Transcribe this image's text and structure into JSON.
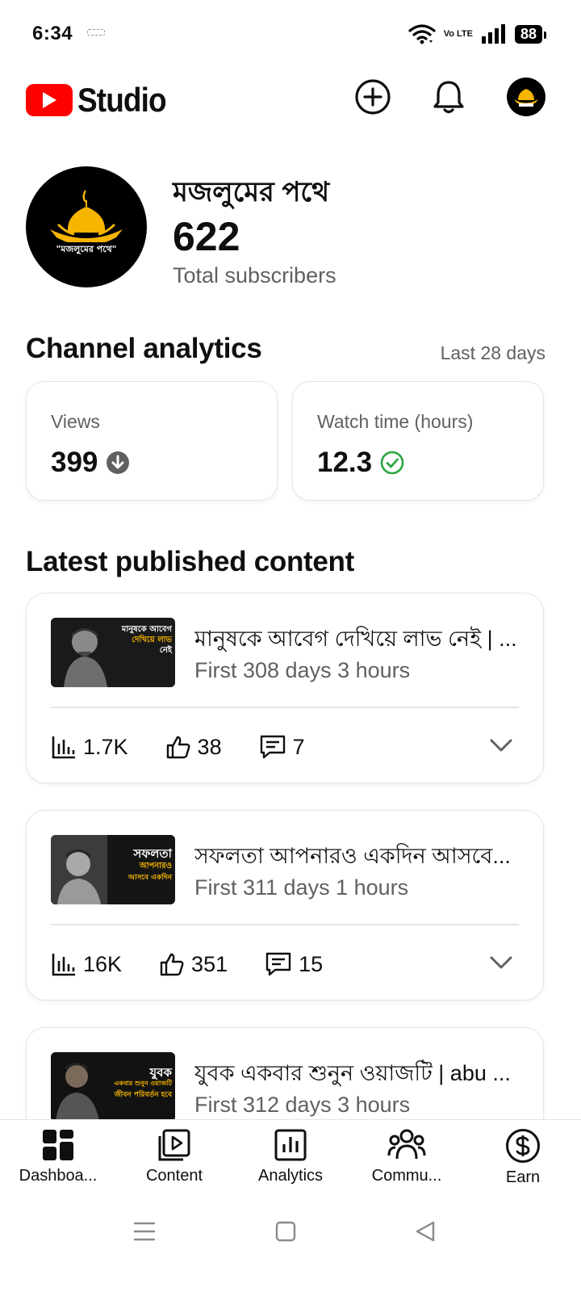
{
  "status_bar": {
    "time": "6:34",
    "network": "Vo LTE",
    "battery": "88"
  },
  "header": {
    "app_name": "Studio",
    "create_icon": "plus-circle-icon",
    "notifications_icon": "bell-icon"
  },
  "channel": {
    "name": "মজলুমের পথে",
    "subscriber_count": "622",
    "subscriber_label": "Total subscribers",
    "avatar_text": "\"মজলুমের পথে\""
  },
  "analytics": {
    "title": "Channel analytics",
    "period": "Last 28 days",
    "metrics": [
      {
        "label": "Views",
        "value": "399",
        "indicator": "down-arrow-icon"
      },
      {
        "label": "Watch time (hours)",
        "value": "12.3",
        "indicator": "check-circle-icon"
      }
    ]
  },
  "latest": {
    "title": "Latest published content",
    "videos": [
      {
        "title": "মানুষকে আবেগ দেখিয়ে লাভ নেই | ...",
        "subtitle": "First 308 days 3 hours",
        "views": "1.7K",
        "likes": "38",
        "comments": "7",
        "thumb_line1": "মানুষকে আবেগ",
        "thumb_line2": "দেখিয়ে লাভ",
        "thumb_line3": "নেই"
      },
      {
        "title": "সফলতা আপনারও একদিন আসবে...",
        "subtitle": "First 311 days 1 hours",
        "views": "16K",
        "likes": "351",
        "comments": "15",
        "thumb_line1": "সফলতা",
        "thumb_line2": "আপনারও",
        "thumb_line3": "আসবে একদিন"
      },
      {
        "title": "যুবক একবার শুনুন ওয়াজটি | abu ...",
        "subtitle": "First 312 days 3 hours",
        "views": "",
        "likes": "",
        "comments": "",
        "thumb_line1": "যুবক",
        "thumb_line2": "একবার শুনুন ওয়াজটি",
        "thumb_line3": "জীবন পরিবর্তন হবে"
      }
    ]
  },
  "bottom_nav": [
    {
      "label": "Dashboa...",
      "icon": "dashboard-icon",
      "active": true
    },
    {
      "label": "Content",
      "icon": "content-icon",
      "active": false
    },
    {
      "label": "Analytics",
      "icon": "analytics-icon",
      "active": false
    },
    {
      "label": "Commu...",
      "icon": "community-icon",
      "active": false
    },
    {
      "label": "Earn",
      "icon": "earn-icon",
      "active": false
    }
  ],
  "colors": {
    "brand_red": "#ff0000",
    "accent_gold": "#f7b500",
    "success_green": "#2ba640",
    "muted_text": "#606060"
  }
}
